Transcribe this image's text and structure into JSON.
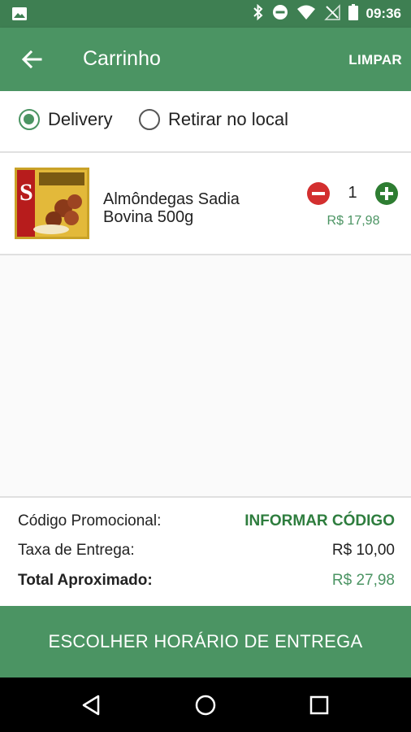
{
  "status_bar": {
    "time": "09:36",
    "icons": [
      "image-icon",
      "bluetooth-icon",
      "do-not-disturb-icon",
      "wifi-icon",
      "no-signal-icon",
      "battery-icon"
    ]
  },
  "app_bar": {
    "title": "Carrinho",
    "clear_label": "LIMPAR",
    "back_icon": "arrow-left-icon"
  },
  "delivery_options": {
    "selected": "delivery",
    "items": [
      {
        "id": "delivery",
        "label": "Delivery"
      },
      {
        "id": "pickup",
        "label": "Retirar no local"
      }
    ]
  },
  "cart": {
    "items": [
      {
        "name": "Almôndegas Sadia Bovina 500g",
        "quantity": "1",
        "price": "R$ 17,98"
      }
    ]
  },
  "summary": {
    "promo_label": "Código Promocional:",
    "promo_action": "INFORMAR CÓDIGO",
    "fee_label": "Taxa de Entrega:",
    "fee_value": "R$ 10,00",
    "total_label": "Total Aproximado:",
    "total_value": "R$ 27,98"
  },
  "cta": {
    "label": "ESCOLHER HORÁRIO DE ENTREGA"
  },
  "nav_bar": {
    "icons": [
      "back-triangle-icon",
      "home-circle-icon",
      "recents-square-icon"
    ]
  },
  "colors": {
    "primary": "#4b9463",
    "status_bar": "#3e7f52",
    "minus": "#d32f2f",
    "plus": "#2e7d32"
  }
}
